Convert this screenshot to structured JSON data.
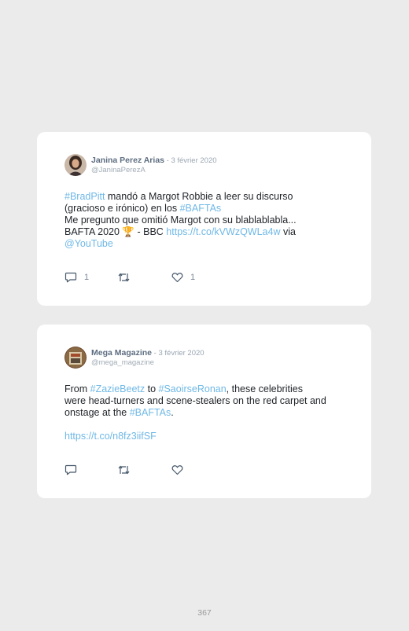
{
  "tweets": [
    {
      "author_name": "Janina Perez Arias",
      "date": " - 3 février 2020",
      "handle": "@JaninaPerezA",
      "line1_hashtag": "#BradPitt",
      "line1_text": " mandó a Margot Robbie a leer su discurso",
      "line2_text": "(gracioso e irónico) en los ",
      "line2_hashtag": "#BAFTAs",
      "line3_text": "Me pregunto que omitió Margot con su blablablabla...",
      "line4_text": "BAFTA 2020 ",
      "line4_emoji": "🏆",
      "line4_text2": " - BBC ",
      "line4_link": "https://t.co/kVWzQWLa4w",
      "line4_text3": " via",
      "line5_mention": "@YouTube",
      "reply_count": "1",
      "like_count": "1",
      "avatar_icon": "avatar-woman"
    },
    {
      "author_name": "Mega Magazine",
      "date": " - 3 février 2020",
      "handle": "@mega_magazine",
      "line1_text": "From ",
      "line1_hashtag1": "#ZazieBeetz",
      "line1_text2": " to ",
      "line1_hashtag2": "#SaoirseRonan",
      "line1_text3": ", these celebrities",
      "line2_text": "were head-turners and scene-stealers on the red carpet and",
      "line3_text": "onstage at the ",
      "line3_hashtag": "#BAFTAs",
      "line3_text2": ".",
      "link": "https://t.co/n8fz3iifSF",
      "avatar_icon": "avatar-magazine"
    }
  ],
  "icons": {
    "reply": "reply-icon",
    "retweet": "retweet-icon",
    "like": "heart-icon"
  },
  "colors": {
    "link": "#6fb8e6",
    "background": "#ebebeb",
    "card": "#ffffff"
  },
  "page_number": "367"
}
